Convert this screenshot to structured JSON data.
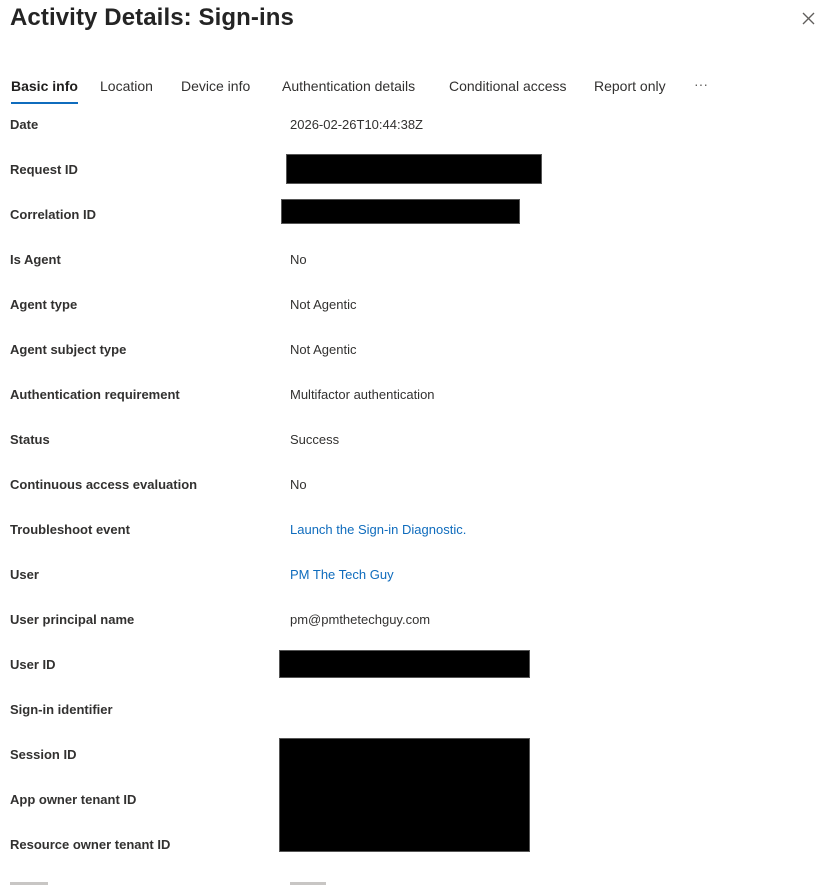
{
  "header": {
    "title": "Activity Details: Sign-ins",
    "close_icon": "close-icon"
  },
  "tabs": [
    {
      "label": "Basic info",
      "active": true
    },
    {
      "label": "Location",
      "active": false
    },
    {
      "label": "Device info",
      "active": false
    },
    {
      "label": "Authentication details",
      "active": false
    },
    {
      "label": "Conditional access",
      "active": false
    },
    {
      "label": "Report only",
      "active": false
    },
    {
      "label": "···",
      "active": false
    }
  ],
  "details": [
    {
      "label": "Date",
      "value": "2026-02-26T10:44:38Z"
    },
    {
      "label": "Request ID",
      "value": "",
      "redacted": true
    },
    {
      "label": "Correlation ID",
      "value": "",
      "redacted": true
    },
    {
      "label": "Is Agent",
      "value": "No"
    },
    {
      "label": "Agent type",
      "value": "Not Agentic"
    },
    {
      "label": "Agent subject type",
      "value": "Not Agentic"
    },
    {
      "label": "Authentication requirement",
      "value": "Multifactor authentication"
    },
    {
      "label": "Status",
      "value": "Success"
    },
    {
      "label": "Continuous access evaluation",
      "value": "No"
    },
    {
      "label": "Troubleshoot event",
      "value": "Launch the Sign-in Diagnostic.",
      "link": true
    },
    {
      "label": "User",
      "value": "PM The Tech Guy",
      "link": true
    },
    {
      "label": "User principal name",
      "value": "pm@pmthetechguy.com"
    },
    {
      "label": "User ID",
      "value": "",
      "redacted": true
    },
    {
      "label": "Sign-in identifier",
      "value": ""
    },
    {
      "label": "Session ID",
      "value": "",
      "redacted": true
    },
    {
      "label": "App owner tenant ID",
      "value": "",
      "redacted": true
    },
    {
      "label": "Resource owner tenant ID",
      "value": "",
      "redacted": true
    }
  ],
  "colors": {
    "accent": "#0f6cbd",
    "redaction": "#000000"
  }
}
